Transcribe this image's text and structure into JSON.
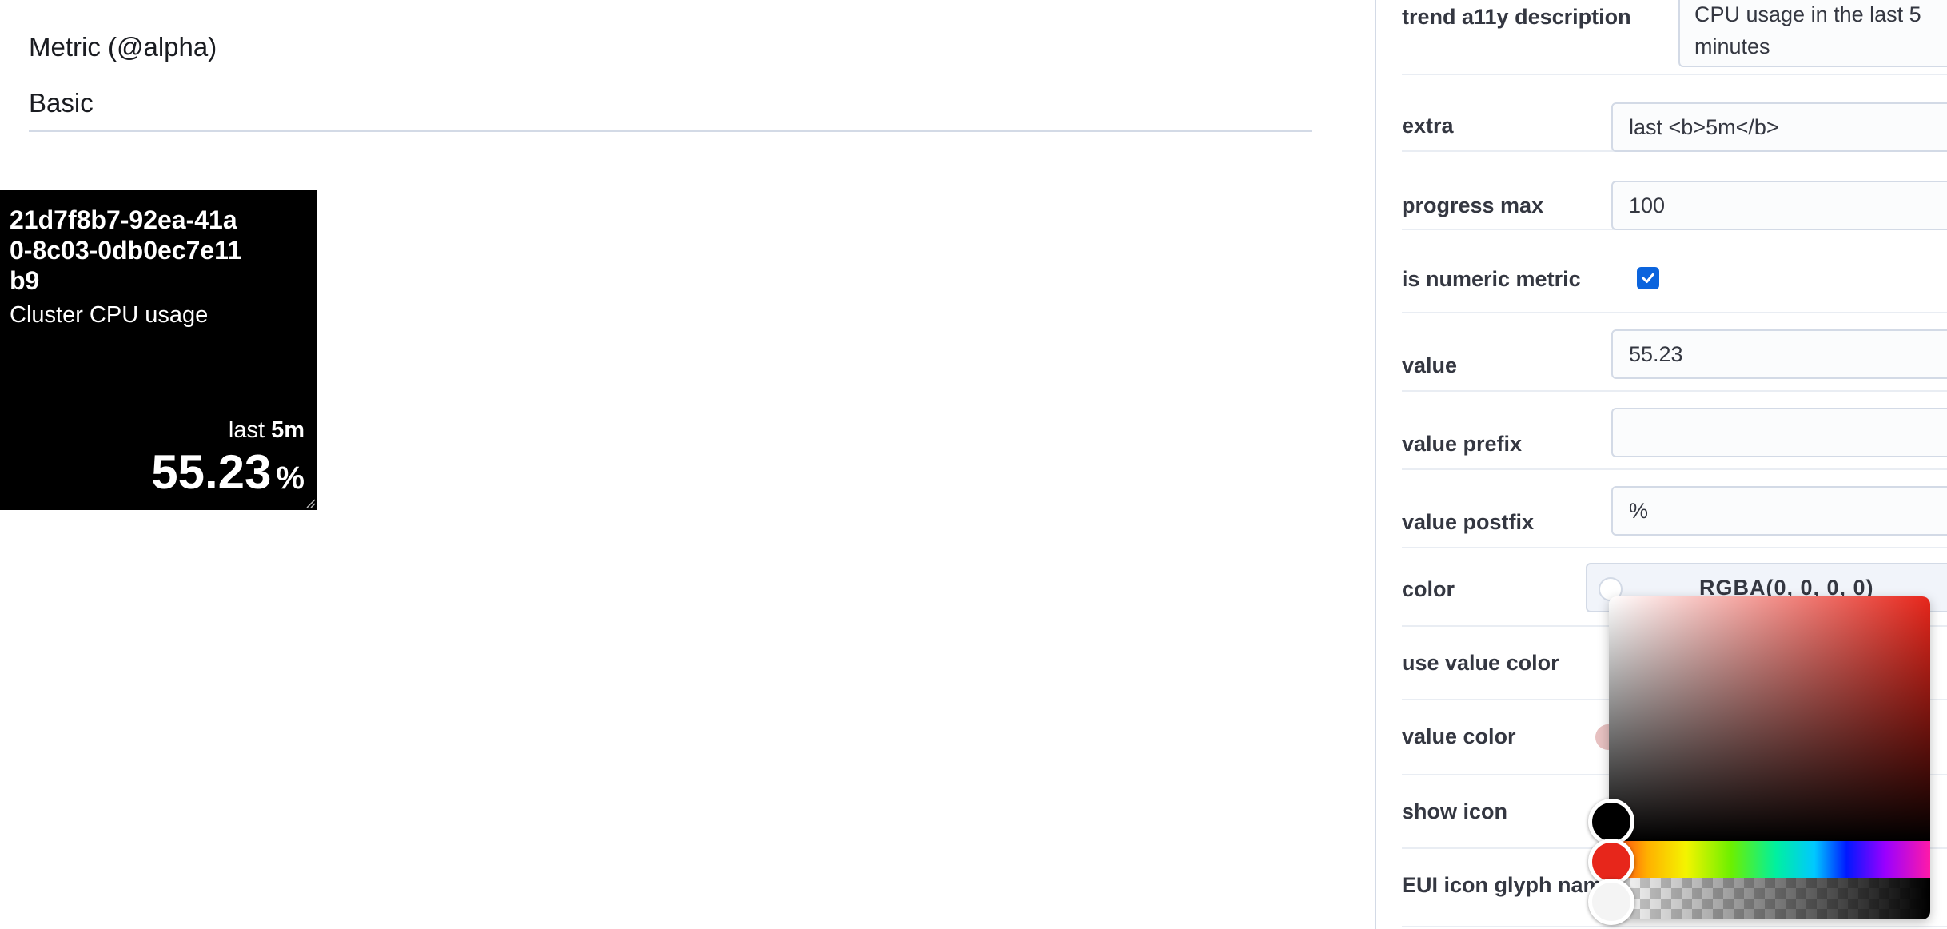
{
  "page": {
    "title": "Metric (@alpha)",
    "section": "Basic"
  },
  "metric": {
    "id": "21d7f8b7-92ea-41a0-8c03-0db0ec7e11b9",
    "subtitle": "Cluster CPU usage",
    "extra_prefix": "last ",
    "extra_bold": "5m",
    "value": "55.23",
    "postfix": "%",
    "card_color": "#000000"
  },
  "props": {
    "trend_a11y": {
      "label": "trend a11y description",
      "value": "CPU usage in the last 5 minutes"
    },
    "extra": {
      "label": "extra",
      "value": "last <b>5m</b>"
    },
    "progress_max": {
      "label": "progress max",
      "value": "100"
    },
    "is_numeric": {
      "label": "is numeric metric",
      "checked": true
    },
    "value": {
      "label": "value",
      "value": "55.23"
    },
    "value_prefix": {
      "label": "value prefix",
      "value": ""
    },
    "value_postfix": {
      "label": "value postfix",
      "value": "%"
    },
    "color": {
      "label": "color",
      "value": "RGBA(0, 0, 0, 0)"
    },
    "use_value_color": {
      "label": "use value color",
      "checked": false
    },
    "value_color": {
      "label": "value color"
    },
    "show_icon": {
      "label": "show icon"
    },
    "icon_glyph": {
      "label": "EUI icon glyph nam"
    }
  },
  "colors": {
    "accent": "#0b64dd",
    "hue_selected": "#e7261b"
  }
}
